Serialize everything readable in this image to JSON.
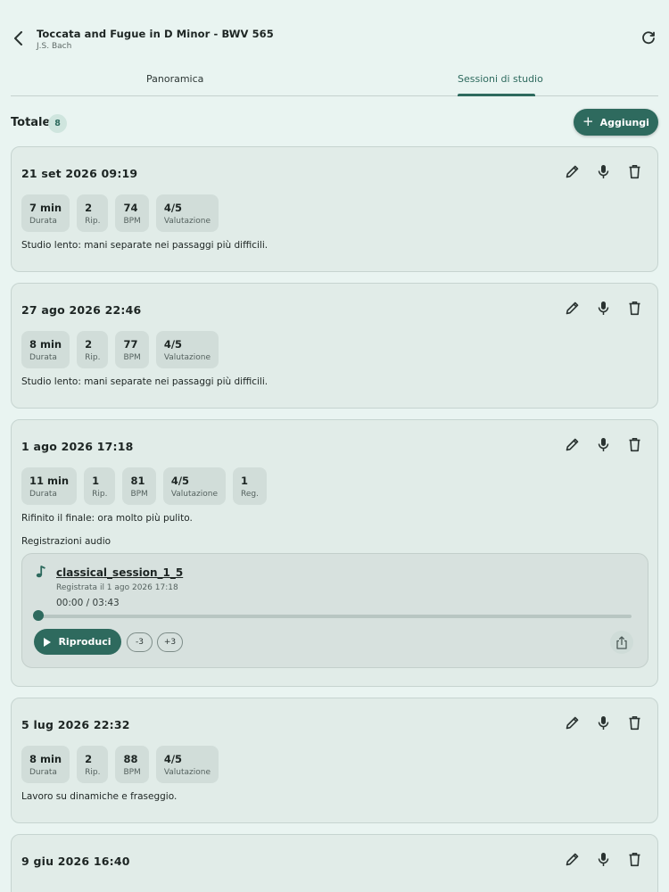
{
  "header": {
    "title": "Toccata and Fugue in D Minor - BWV 565",
    "subtitle": "J.S. Bach"
  },
  "tabs": [
    {
      "label": "Panoramica",
      "active": false
    },
    {
      "label": "Sessioni di studio",
      "active": true
    }
  ],
  "summary": {
    "total_label": "Totale",
    "total_count": "8",
    "add_label": "Aggiungi"
  },
  "colors": {
    "accent": "#2e6a5e",
    "background": "#e9f4f1",
    "card": "#e1ece8"
  },
  "sessions": [
    {
      "date": "21 set 2026 09:19",
      "stats": [
        {
          "value": "7 min",
          "label": "Durata"
        },
        {
          "value": "2",
          "label": "Rip."
        },
        {
          "value": "74",
          "label": "BPM"
        },
        {
          "value": "4/5",
          "label": "Valutazione"
        }
      ],
      "note": "Studio lento: mani separate nei passaggi più difficili."
    },
    {
      "date": "27 ago 2026 22:46",
      "stats": [
        {
          "value": "8 min",
          "label": "Durata"
        },
        {
          "value": "2",
          "label": "Rip."
        },
        {
          "value": "77",
          "label": "BPM"
        },
        {
          "value": "4/5",
          "label": "Valutazione"
        }
      ],
      "note": "Studio lento: mani separate nei passaggi più difficili."
    },
    {
      "date": "1 ago 2026 17:18",
      "stats": [
        {
          "value": "11 min",
          "label": "Durata"
        },
        {
          "value": "1",
          "label": "Rip."
        },
        {
          "value": "81",
          "label": "BPM"
        },
        {
          "value": "4/5",
          "label": "Valutazione"
        },
        {
          "value": "1",
          "label": "Reg."
        }
      ],
      "note": "Rifinito il finale: ora molto più pulito.",
      "recordings_heading": "Registrazioni audio",
      "recording": {
        "name": "classical_session_1_5",
        "recorded": "Registrata il 1 ago 2026 17:18",
        "time": "00:00 / 03:43",
        "progress": 0,
        "play_label": "Riproduci",
        "skip_back": "-3",
        "skip_forward": "+3"
      }
    },
    {
      "date": "5 lug 2026 22:32",
      "stats": [
        {
          "value": "8 min",
          "label": "Durata"
        },
        {
          "value": "2",
          "label": "Rip."
        },
        {
          "value": "88",
          "label": "BPM"
        },
        {
          "value": "4/5",
          "label": "Valutazione"
        }
      ],
      "note": "Lavoro su dinamiche e fraseggio."
    },
    {
      "date": "9 giu 2026 16:40"
    }
  ]
}
